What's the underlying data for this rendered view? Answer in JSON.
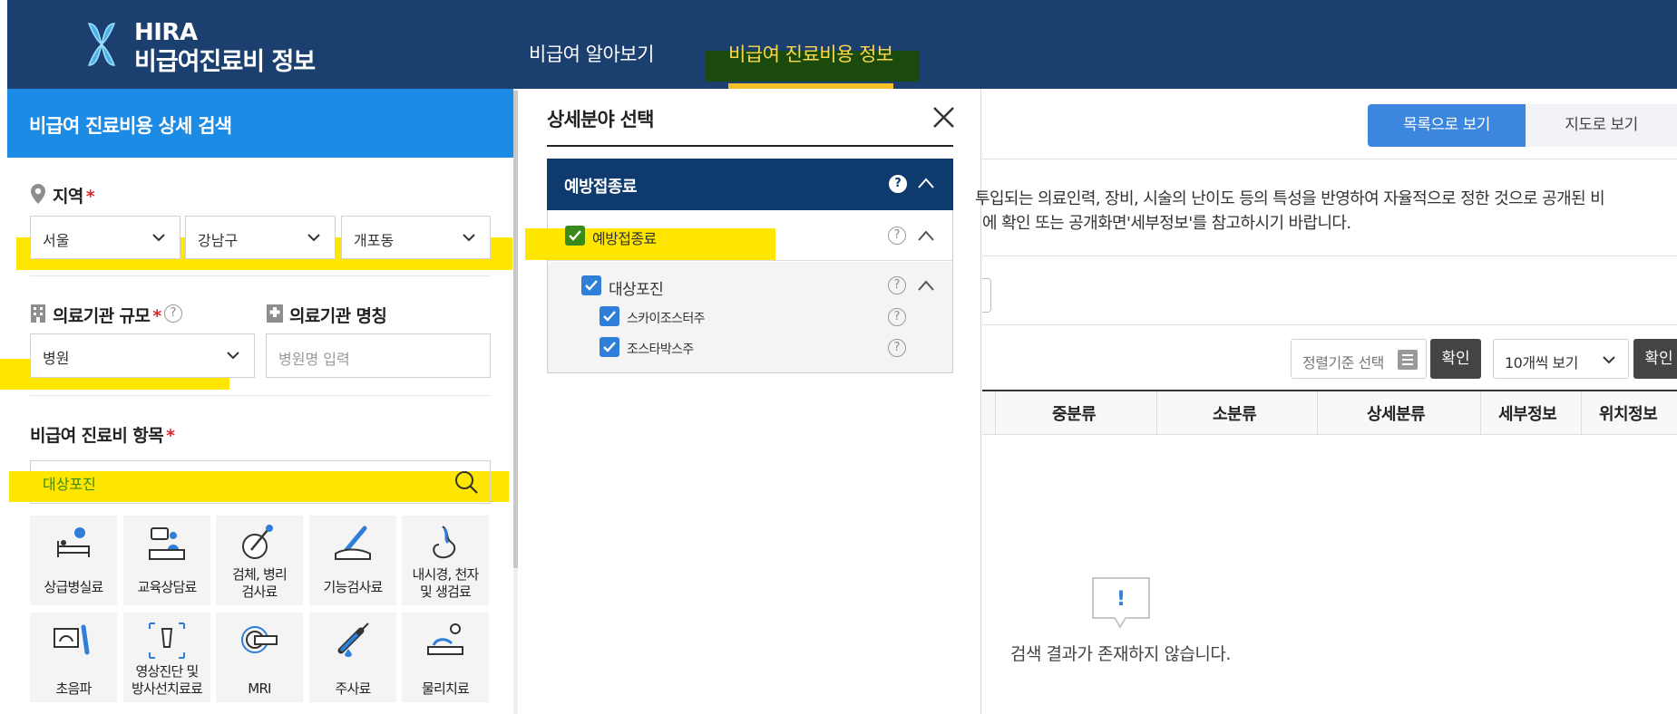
{
  "header": {
    "brand_line1": "HIRA",
    "brand_line2": "비급여진료비 정보",
    "nav": [
      {
        "label": "비급여 알아보기"
      },
      {
        "label": "비급여 진료비용 정보",
        "active": true
      }
    ]
  },
  "left": {
    "title": "비급여 진료비용 상세 검색",
    "region_label": "지역",
    "required_mark": "*",
    "region": {
      "city": "서울",
      "district": "강남구",
      "dong": "개포동"
    },
    "scale_label": "의료기관 규모",
    "scale_value": "병원",
    "name_label": "의료기관 명칭",
    "name_placeholder": "병원명 입력",
    "item_label": "비급여 진료비 항목",
    "item_value": "대상포진",
    "categories": [
      {
        "line1": "상급병실료",
        "line2": "",
        "icon": "hospital-bed-icon"
      },
      {
        "line1": "교육상담료",
        "line2": "",
        "icon": "counseling-icon"
      },
      {
        "line1": "검체, 병리",
        "line2": "검사료",
        "icon": "specimen-test-icon"
      },
      {
        "line1": "기능검사료",
        "line2": "",
        "icon": "function-test-icon"
      },
      {
        "line1": "내시경, 천자",
        "line2": "및 생검료",
        "icon": "endoscope-icon"
      },
      {
        "line1": "초음파",
        "line2": "",
        "icon": "ultrasound-icon"
      },
      {
        "line1": "영상진단 및",
        "line2": "방사선치료료",
        "icon": "imaging-icon"
      },
      {
        "line1": "MRI",
        "line2": "",
        "icon": "mri-icon"
      },
      {
        "line1": "주사료",
        "line2": "",
        "icon": "syringe-icon"
      },
      {
        "line1": "물리치료",
        "line2": "",
        "icon": "physical-therapy-icon"
      }
    ]
  },
  "modal": {
    "title": "상세분야 선택",
    "group": "예방접종료",
    "item": "예방접종료",
    "sub_item": "대상포진",
    "children": [
      "스카이조스터주",
      "조스타박스주"
    ],
    "help": "?"
  },
  "right": {
    "view_list": "목록으로 보기",
    "view_map": "지도로 보기",
    "notice_line1": "투입되는 의료인력, 장비, 시술의 난이도 등의 특성을 반영하여 자율적으로 정한 것으로 공개된 비",
    "notice_line2": "에 확인 또는 공개화면'세부정보'를 참고하시기 바랍니다.",
    "sort_placeholder": "정렬기준 선택",
    "confirm": "확인",
    "per_page": "10개씩 보기",
    "columns": [
      "중분류",
      "소분류",
      "상세분류",
      "세부정보",
      "위치정보"
    ],
    "empty_message": "검색 결과가 존재하지 않습니다.",
    "empty_icon_glyph": "!"
  },
  "colors": {
    "header_bg": "#1b3f6e",
    "left_head_bg": "#1c8be6",
    "nav_active": "#ffd84a",
    "highlight": "#ffe600",
    "tree_head_bg": "#0e3a6e",
    "checkbox": "#2f7fd8",
    "list_button": "#3d86dd"
  }
}
